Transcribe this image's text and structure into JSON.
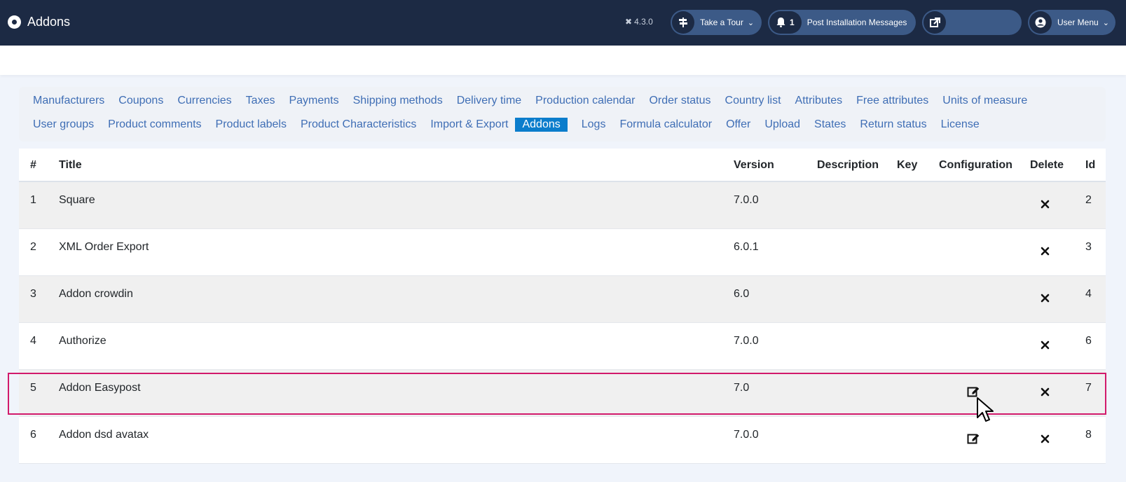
{
  "header": {
    "title": "Addons",
    "version": "4.3.0",
    "tour_label": "Take a Tour",
    "post_count": "1",
    "post_label": "Post Installation Messages",
    "user_label": "User Menu"
  },
  "nav": {
    "row1": [
      "Manufacturers",
      "Coupons",
      "Currencies",
      "Taxes",
      "Payments",
      "Shipping methods",
      "Delivery time",
      "Production calendar",
      "Order status",
      "Country list",
      "Attributes",
      "Free attributes",
      "Units of measure"
    ],
    "row2": [
      "User groups",
      "Product comments",
      "Product labels",
      "Product Characteristics",
      "Import & Export",
      "Addons",
      "Logs",
      "Formula calculator",
      "Offer",
      "Upload",
      "States",
      "Return status",
      "License"
    ],
    "active": "Addons"
  },
  "table": {
    "headers": {
      "num": "#",
      "title": "Title",
      "version": "Version",
      "description": "Description",
      "key": "Key",
      "configuration": "Configuration",
      "delete": "Delete",
      "id": "Id"
    },
    "rows": [
      {
        "num": "1",
        "title": "Square",
        "version": "7.0.0",
        "id": "2",
        "has_config": false
      },
      {
        "num": "2",
        "title": "XML Order Export",
        "version": "6.0.1",
        "id": "3",
        "has_config": false
      },
      {
        "num": "3",
        "title": "Addon crowdin",
        "version": "6.0",
        "id": "4",
        "has_config": false
      },
      {
        "num": "4",
        "title": "Authorize",
        "version": "7.0.0",
        "id": "6",
        "has_config": false
      },
      {
        "num": "5",
        "title": "Addon Easypost",
        "version": "7.0",
        "id": "7",
        "has_config": true
      },
      {
        "num": "6",
        "title": "Addon dsd avatax",
        "version": "7.0.0",
        "id": "8",
        "has_config": true
      }
    ]
  },
  "colors": {
    "header_bg": "#1c2a44",
    "pill_bg": "#3c5a87",
    "link": "#3f6eb5",
    "active_bg": "#0b7dcc",
    "highlight": "#d21a6b"
  },
  "icons": {
    "brand": "joomla-logo-icon",
    "tour": "signpost-icon",
    "post": "bell-icon",
    "ext": "external-link-icon",
    "user": "user-circle-icon",
    "delete": "close-icon",
    "config": "edit-icon"
  }
}
